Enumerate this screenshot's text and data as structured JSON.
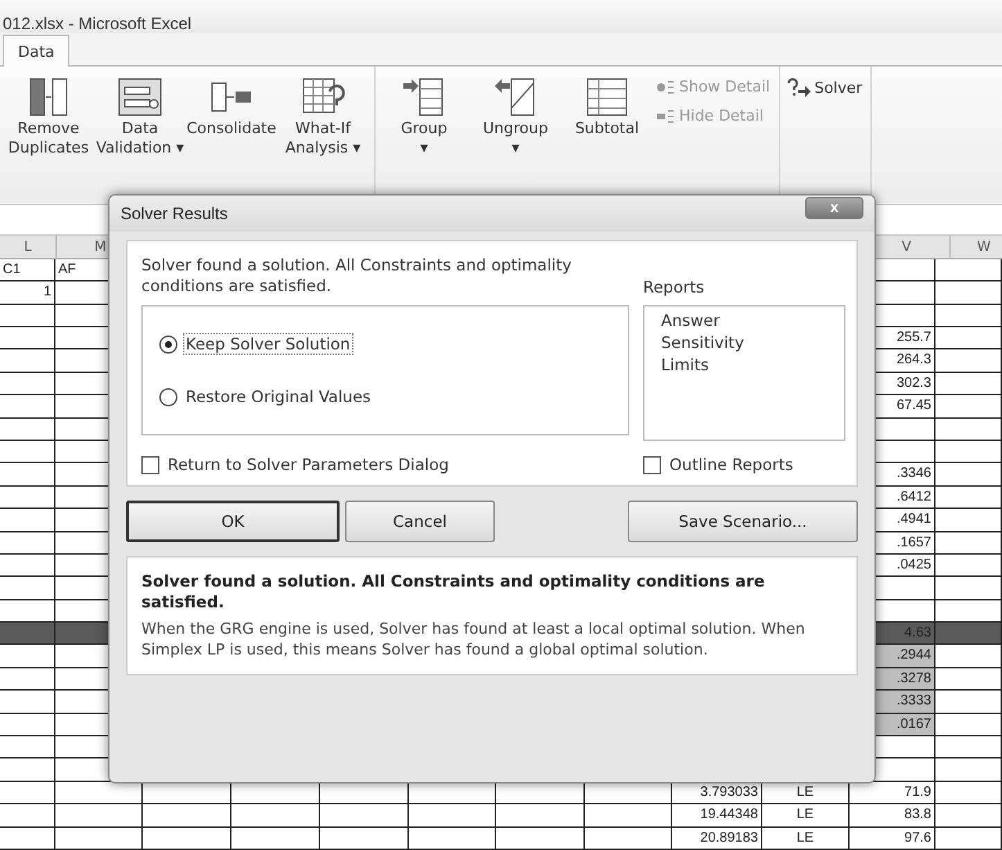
{
  "window": {
    "title": "012.xlsx -  Microsoft Excel"
  },
  "tabs": [
    {
      "label": "Data",
      "selected": true
    }
  ],
  "ribbon": {
    "groups": [
      {
        "items": [
          {
            "kind": "large",
            "lines": [
              "Remove",
              "Duplicates"
            ]
          },
          {
            "kind": "large",
            "lines": [
              "Data",
              "Validation ▾"
            ]
          },
          {
            "kind": "large",
            "lines": [
              "Consolidate"
            ]
          },
          {
            "kind": "large",
            "lines": [
              "What-If",
              "Analysis ▾"
            ]
          }
        ]
      },
      {
        "items": [
          {
            "kind": "large",
            "lines": [
              "Group",
              "▾"
            ]
          },
          {
            "kind": "large",
            "lines": [
              "Ungroup",
              "▾"
            ]
          },
          {
            "kind": "large",
            "lines": [
              "Subtotal"
            ]
          },
          {
            "kind": "small",
            "lines": [
              "Show Detail"
            ],
            "disabled": true
          },
          {
            "kind": "small",
            "lines": [
              "Hide Detail"
            ],
            "disabled": true
          }
        ]
      },
      {
        "items": [
          {
            "kind": "small",
            "lines": [
              "Solver"
            ],
            "disabled": false
          }
        ]
      }
    ]
  },
  "sheet": {
    "headers": {
      "L": "L",
      "M": "M",
      "V": "V",
      "W": "W"
    },
    "rows": [
      {
        "kind": "plain",
        "cells": {
          "L": "C1",
          "M": "AF"
        }
      },
      {
        "kind": "plain",
        "cells": {
          "L": "1"
        }
      },
      {
        "kind": "plain",
        "cells": {}
      },
      {
        "kind": "plain",
        "cells": {
          "V": "255.7"
        }
      },
      {
        "kind": "plain",
        "cells": {
          "V": "264.3"
        }
      },
      {
        "kind": "plain",
        "cells": {
          "V": "302.3"
        }
      },
      {
        "kind": "plain",
        "cells": {
          "V": "67.45"
        }
      },
      {
        "kind": "plain",
        "cells": {}
      },
      {
        "kind": "plain",
        "cells": {}
      },
      {
        "kind": "plain",
        "cells": {
          "V": ".3346"
        }
      },
      {
        "kind": "plain",
        "cells": {
          "V": ".6412"
        }
      },
      {
        "kind": "plain",
        "cells": {
          "V": ".4941"
        }
      },
      {
        "kind": "plain",
        "cells": {
          "V": ".1657"
        }
      },
      {
        "kind": "plain",
        "cells": {
          "V": ".0425"
        }
      },
      {
        "kind": "plain",
        "cells": {}
      },
      {
        "kind": "plain",
        "cells": {}
      },
      {
        "kind": "dark",
        "cells": {
          "V": "4.63"
        }
      },
      {
        "kind": "shaded",
        "cells": {
          "V": ".2944"
        }
      },
      {
        "kind": "shaded",
        "cells": {
          "V": ".3278"
        }
      },
      {
        "kind": "shaded",
        "cells": {
          "V": ".3333"
        }
      },
      {
        "kind": "shaded",
        "cells": {
          "V": ".0167"
        }
      },
      {
        "kind": "plain",
        "cells": {}
      },
      {
        "kind": "plain",
        "cells": {}
      },
      {
        "kind": "plain",
        "cells": {
          "T": "3.793033",
          "U": "LE",
          "V": "71.9"
        }
      },
      {
        "kind": "plain",
        "cells": {
          "T": "19.44348",
          "U": "LE",
          "V": "83.8"
        }
      },
      {
        "kind": "plain",
        "cells": {
          "T": "20.89183",
          "U": "LE",
          "V": "97.6"
        }
      }
    ]
  },
  "dialog": {
    "title": "Solver Results",
    "close": "x",
    "message": "Solver found a solution.  All Constraints and optimality conditions are satisfied.",
    "options": [
      {
        "label": "Keep Solver Solution",
        "selected": true
      },
      {
        "label": "Restore Original Values",
        "selected": false
      }
    ],
    "reports_label": "Reports",
    "reports": [
      "Answer",
      "Sensitivity",
      "Limits"
    ],
    "checkboxes": [
      {
        "label": "Return to Solver Parameters Dialog",
        "checked": false
      },
      {
        "label": "Outline Reports",
        "checked": false
      }
    ],
    "buttons": [
      {
        "label": "OK",
        "default": true
      },
      {
        "label": "Cancel",
        "default": false
      },
      {
        "label": "Save Scenario...",
        "default": false
      }
    ],
    "info_title": "Solver found a solution.  All Constraints and optimality conditions are satisfied.",
    "info_text": "When the GRG engine is used, Solver has found at least a local optimal solution. When Simplex LP is used, this means Solver has found a global optimal solution."
  }
}
